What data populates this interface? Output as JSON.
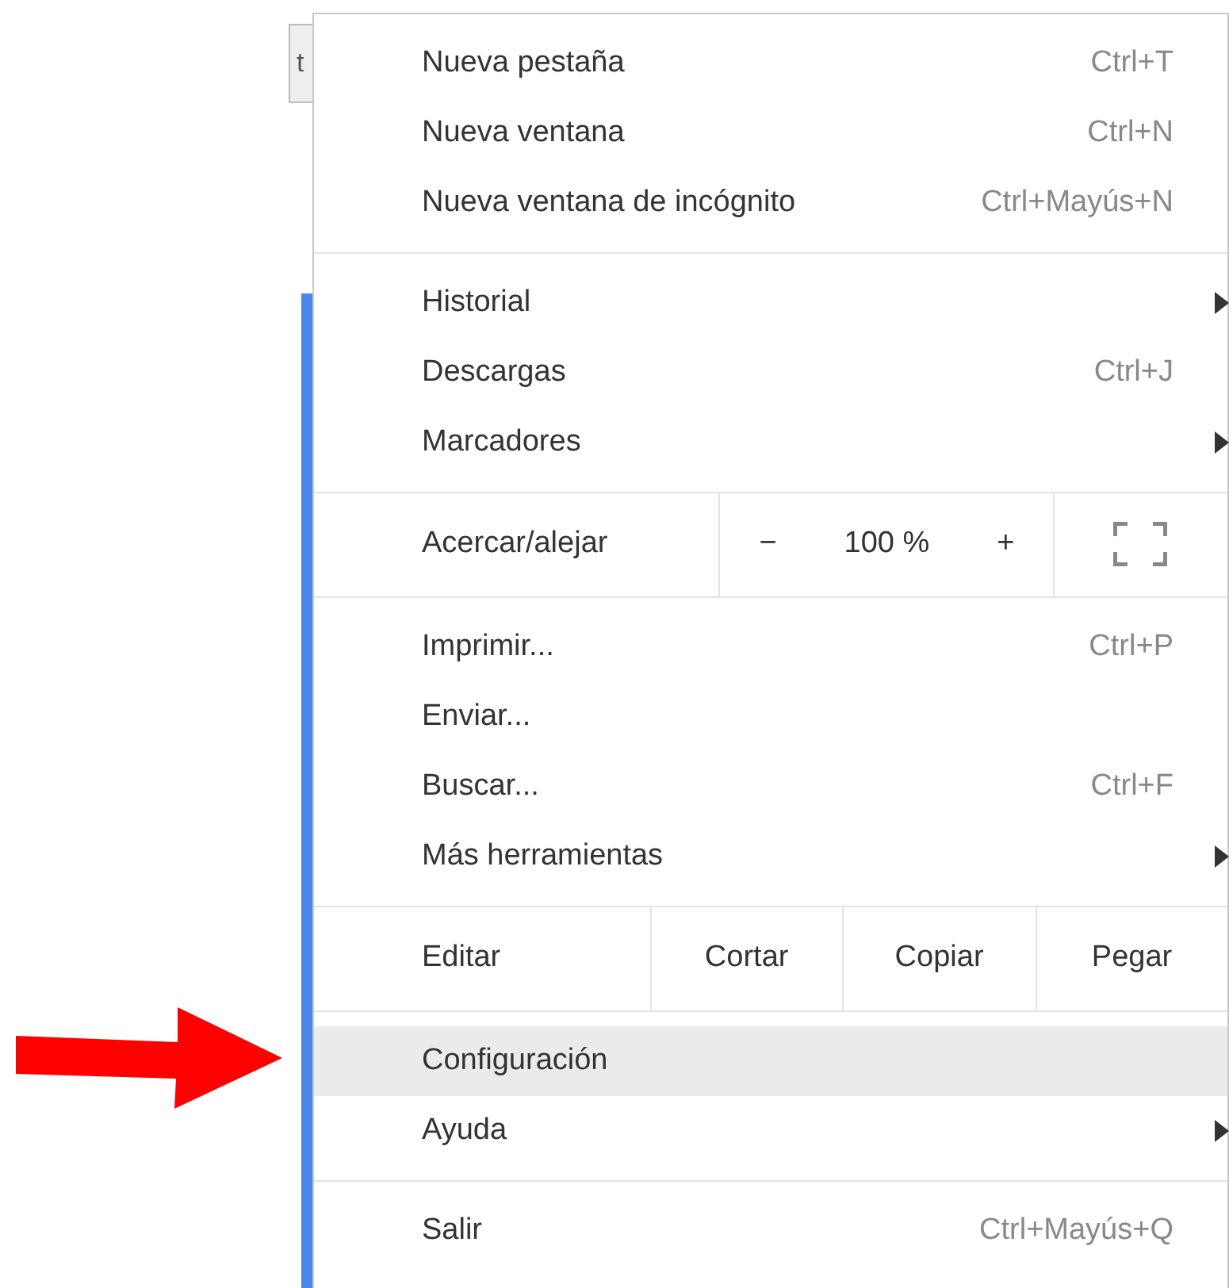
{
  "background": {
    "field_text": "t"
  },
  "menu": {
    "sections": [
      {
        "kind": "list",
        "items": [
          {
            "label": "Nueva pestaña",
            "shortcut": "Ctrl+T",
            "submenu": false,
            "selected": false
          },
          {
            "label": "Nueva ventana",
            "shortcut": "Ctrl+N",
            "submenu": false,
            "selected": false
          },
          {
            "label": "Nueva ventana de incógnito",
            "shortcut": "Ctrl+Mayús+N",
            "submenu": false,
            "selected": false
          }
        ]
      },
      {
        "kind": "list",
        "items": [
          {
            "label": "Historial",
            "submenu": true,
            "selected": false
          },
          {
            "label": "Descargas",
            "shortcut": "Ctrl+J",
            "submenu": false,
            "selected": false
          },
          {
            "label": "Marcadores",
            "submenu": true,
            "selected": false
          }
        ]
      },
      {
        "kind": "zoom",
        "label": "Acercar/alejar",
        "minus": "−",
        "value": "100 %",
        "plus": "+"
      },
      {
        "kind": "list",
        "items": [
          {
            "label": "Imprimir...",
            "shortcut": "Ctrl+P",
            "submenu": false,
            "selected": false
          },
          {
            "label": "Enviar...",
            "submenu": false,
            "selected": false
          },
          {
            "label": "Buscar...",
            "shortcut": "Ctrl+F",
            "submenu": false,
            "selected": false
          },
          {
            "label": "Más herramientas",
            "submenu": true,
            "selected": false
          }
        ]
      },
      {
        "kind": "edit",
        "label": "Editar",
        "buttons": [
          "Cortar",
          "Copiar",
          "Pegar"
        ]
      },
      {
        "kind": "list",
        "items": [
          {
            "label": "Configuración",
            "submenu": false,
            "selected": true
          },
          {
            "label": "Ayuda",
            "submenu": true,
            "selected": false
          }
        ]
      },
      {
        "kind": "list",
        "items": [
          {
            "label": "Salir",
            "shortcut": "Ctrl+Mayús+Q",
            "submenu": false,
            "selected": false
          }
        ]
      }
    ]
  }
}
